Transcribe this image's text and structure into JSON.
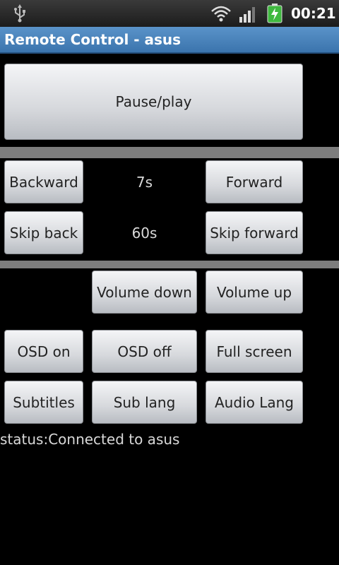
{
  "statusbar": {
    "time": "00:21",
    "icons": [
      "usb-icon",
      "wifi-icon",
      "signal-icon",
      "battery-charging-icon"
    ]
  },
  "titlebar": {
    "title": "Remote Control - asus"
  },
  "controls": {
    "pause_play": "Pause/play",
    "backward": "Backward",
    "small_step": "7s",
    "forward": "Forward",
    "skip_back": "Skip back",
    "big_step": "60s",
    "skip_forward": "Skip forward",
    "volume_down": "Volume down",
    "volume_up": "Volume up",
    "osd_on": "OSD on",
    "osd_off": "OSD off",
    "full_screen": "Full screen",
    "subtitles": "Subtitles",
    "sub_lang": "Sub lang",
    "audio_lang": "Audio Lang"
  },
  "status": {
    "text": "status:Connected to asus"
  },
  "colors": {
    "titlebar": "#4a84bd",
    "divider": "#7e7e7e",
    "background": "#000000"
  }
}
